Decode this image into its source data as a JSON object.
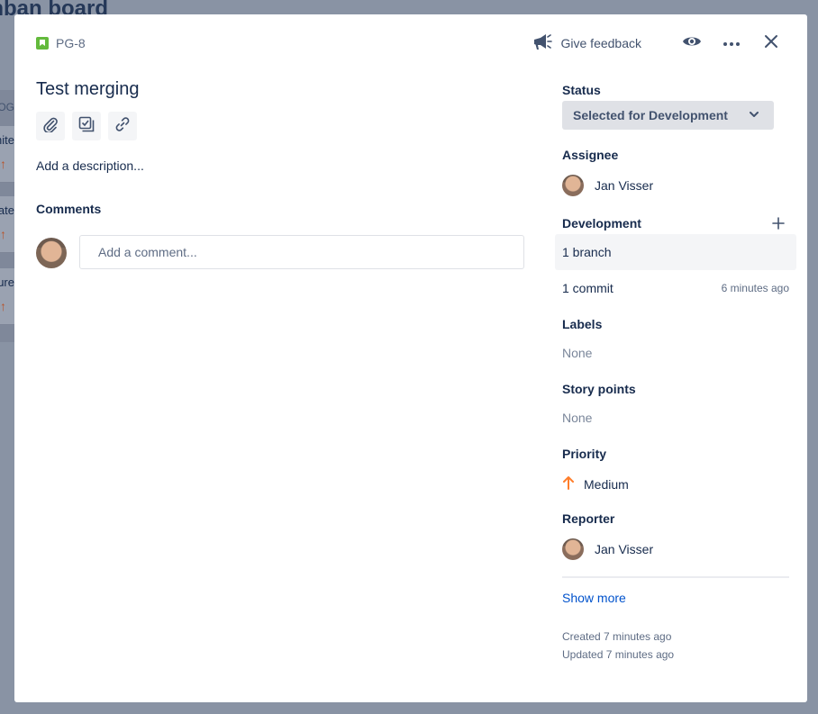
{
  "background": {
    "board_title": "Kanban board",
    "backlog_label": "BACKLOG",
    "cards": [
      {
        "title": "Unite"
      },
      {
        "title": "Create"
      },
      {
        "title": "Feature"
      }
    ]
  },
  "issue": {
    "key": "PG-8",
    "title": "Test merging",
    "description_placeholder": "Add a description...",
    "comments_heading": "Comments",
    "comment_placeholder": "Add a comment..."
  },
  "header": {
    "feedback_label": "Give feedback",
    "icons": [
      "megaphone-icon",
      "watch-eye-icon",
      "more-icon",
      "close-icon"
    ]
  },
  "toolbar": {
    "icons": [
      "attachment-icon",
      "subtask-icon",
      "link-icon"
    ]
  },
  "sidebar": {
    "status_label": "Status",
    "status_value": "Selected for Development",
    "assignee_label": "Assignee",
    "assignee_name": "Jan Visser",
    "development_label": "Development",
    "branch_text": "1 branch",
    "commit_text": "1 commit",
    "commit_time": "6 minutes ago",
    "labels_label": "Labels",
    "labels_value": "None",
    "story_points_label": "Story points",
    "story_points_value": "None",
    "priority_label": "Priority",
    "priority_value": "Medium",
    "reporter_label": "Reporter",
    "reporter_name": "Jan Visser",
    "show_more": "Show more",
    "created": "Created 7 minutes ago",
    "updated": "Updated 7 minutes ago"
  },
  "colors": {
    "accent": "#0052cc",
    "story": "#63ba3c",
    "priority_medium": "#ff7e2b",
    "overlay": "#8993a4"
  }
}
